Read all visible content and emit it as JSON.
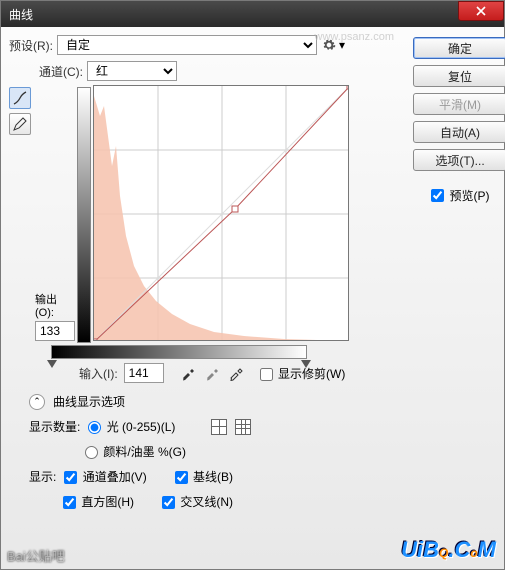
{
  "title": "曲线",
  "preset": {
    "label": "预设(R):",
    "value": "自定"
  },
  "channel": {
    "label": "通道(C):",
    "value": "红"
  },
  "output": {
    "label": "输出(O):",
    "value": "133"
  },
  "input": {
    "label": "输入(I):",
    "value": "141"
  },
  "show_clip": "显示修剪(W)",
  "curve_opts_label": "曲线显示选项",
  "amount_label": "显示数量:",
  "amount_light": "光 (0-255)(L)",
  "amount_ink": "颜料/油墨 %(G)",
  "show_label": "显示:",
  "chk_overlay": "通道叠加(V)",
  "chk_baseline": "基线(B)",
  "chk_hist": "直方图(H)",
  "chk_cross": "交叉线(N)",
  "buttons": {
    "ok": "确定",
    "reset": "复位",
    "smooth": "平滑(M)",
    "auto": "自动(A)",
    "options": "选项(T)...",
    "preview": "预览(P)"
  },
  "watermark_baidu": "Bai公贴吧",
  "watermark_site": "www.psanz.com",
  "watermark_logo": "UiBQ.CoM",
  "chart_data": {
    "type": "line",
    "title": "曲线 - 红",
    "xlabel": "输入",
    "ylabel": "输出",
    "xlim": [
      0,
      255
    ],
    "ylim": [
      0,
      255
    ],
    "points": [
      {
        "x": 0,
        "y": 0
      },
      {
        "x": 141,
        "y": 133
      },
      {
        "x": 255,
        "y": 255
      }
    ],
    "histogram_note": "左侧高密度、向右快速衰减的红色通道直方图"
  }
}
